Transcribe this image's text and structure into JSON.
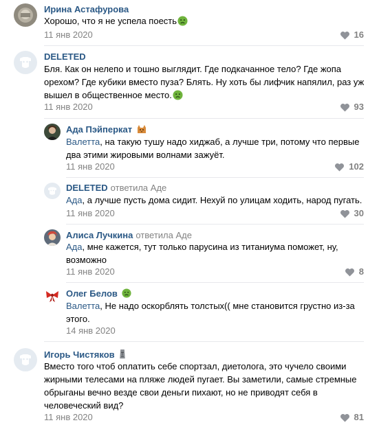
{
  "colors": {
    "link": "#2a5885",
    "meta": "#828282",
    "divider": "#e7e8ec",
    "emoji_green": "#6fb33c"
  },
  "comments": [
    {
      "author": "Ирина Астафурова",
      "text": "Хорошо, что я не успела поесть",
      "emoji": "nauseated-face-icon",
      "date": "11 янв 2020",
      "likes": "16"
    },
    {
      "author": "DELETED",
      "text": "Бля. Как он нелепо и тошно выглядит. Где подкачанное тело? Где жопа орехом? Где кубики вместо пуза? Блять. Ну хоть бы лифчик напялил, раз уж вышел в общественное место.",
      "emoji": "nauseated-face-icon",
      "date": "11 янв 2020",
      "likes": "93"
    },
    {
      "author": "Ада Пэйперкат",
      "badge": "cat-icon",
      "mention": "Валетта",
      "text": ", на такую тушу надо хиджаб, а лучше три, потому что первые два этими жировыми волнами зажуёт.",
      "date": "11 янв 2020",
      "likes": "102"
    },
    {
      "author": "DELETED",
      "reply_word": "ответила",
      "reply_target": "Аде",
      "mention": "Ада",
      "text": ", а лучше пусть дома сидит. Нехуй по улицам ходить, народ пугать.",
      "date": "11 янв 2020",
      "likes": "30"
    },
    {
      "author": "Алиса Лучкина",
      "reply_word": "ответила",
      "reply_target": "Аде",
      "mention": "Ада",
      "text": ", мне кажется, тут только парусина из титаниума поможет, ну, возможно",
      "date": "11 янв 2020",
      "likes": "8"
    },
    {
      "author": "Олег Белов",
      "badge": "nauseated-face-icon",
      "mention": "Валетта",
      "text": ", Не надо оскорблять толстых(( мне становится грустно из-за этого.",
      "date": "14 янв 2020"
    },
    {
      "author": "Игорь Чистяков",
      "badge": "moai-icon",
      "text": "Вместо того чтоб оплатить себе спортзал, диетолога, это чучело своими жирными телесами на пляже людей пугает. Вы заметили, самые стремные обрыганы вечно везде свои деньги пихают, но не приводят себя в человеческий вид?",
      "date": "11 янв 2020",
      "likes": "81"
    }
  ]
}
